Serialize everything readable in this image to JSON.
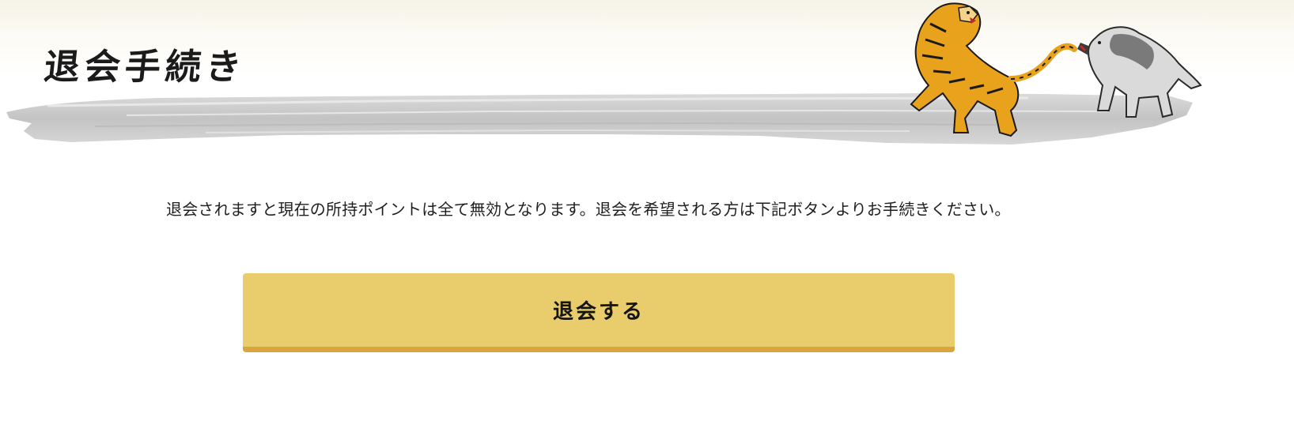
{
  "header": {
    "title": "退会手続き",
    "illustration": "tiger-and-wolf-illustration",
    "brush_color": "#c9c8c8"
  },
  "main": {
    "notice": "退会されますと現在の所持ポイントは全て無効となります。退会を希望される方は下記ボタンよりお手続きください。",
    "withdraw_button_label": "退会する"
  },
  "colors": {
    "button": "#e9cc6b",
    "button_border": "#d9a63d",
    "tiger": "#e8a21c",
    "wolf": "#b9b9b9"
  }
}
